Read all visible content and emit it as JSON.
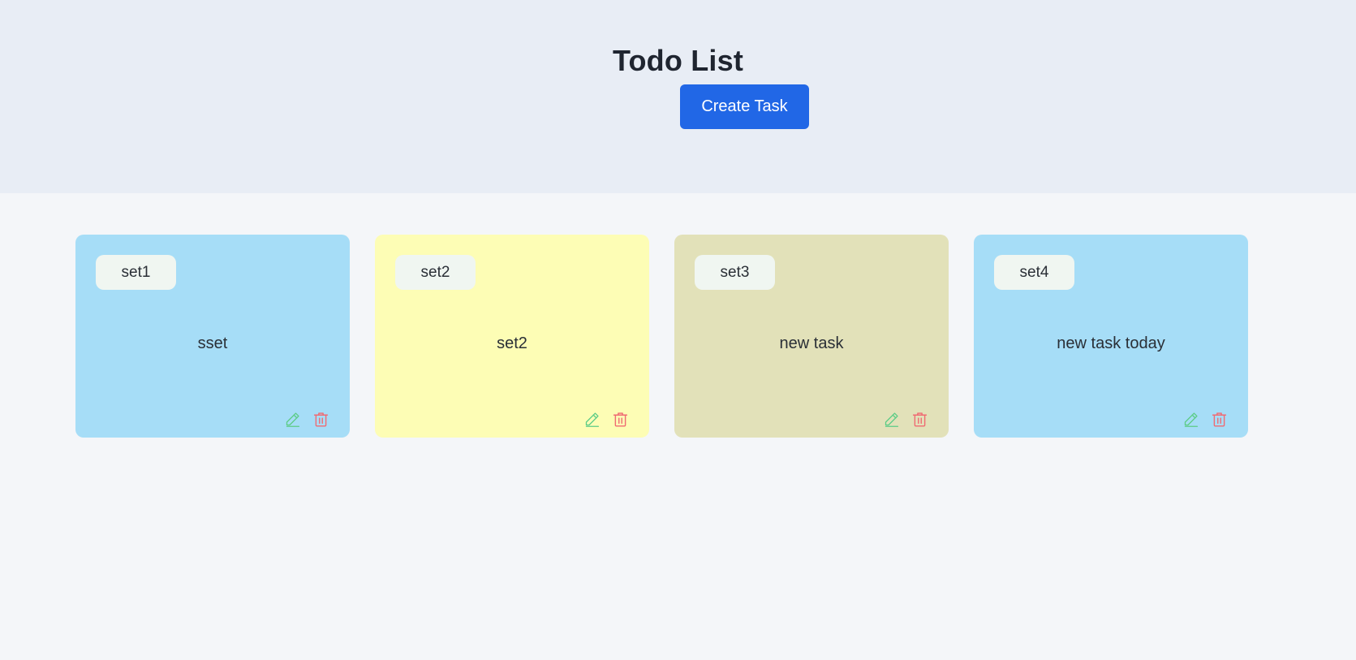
{
  "header": {
    "title": "Todo List",
    "create_button_label": "Create Task"
  },
  "colors": {
    "accent": "#2167e6",
    "edit_icon": "#5ccc86",
    "delete_icon": "#f06a72"
  },
  "tasks": [
    {
      "badge": "set1",
      "text": "sset",
      "color": "#a6ddf7",
      "edit_icon": "pencil-icon",
      "delete_icon": "trash-icon"
    },
    {
      "badge": "set2",
      "text": "set2",
      "color": "#fdfdb5",
      "edit_icon": "pencil-icon",
      "delete_icon": "trash-icon"
    },
    {
      "badge": "set3",
      "text": "new task",
      "color": "#e2e1b9",
      "edit_icon": "pencil-icon",
      "delete_icon": "trash-icon"
    },
    {
      "badge": "set4",
      "text": "new task today",
      "color": "#a6ddf7",
      "edit_icon": "pencil-icon",
      "delete_icon": "trash-icon"
    }
  ]
}
